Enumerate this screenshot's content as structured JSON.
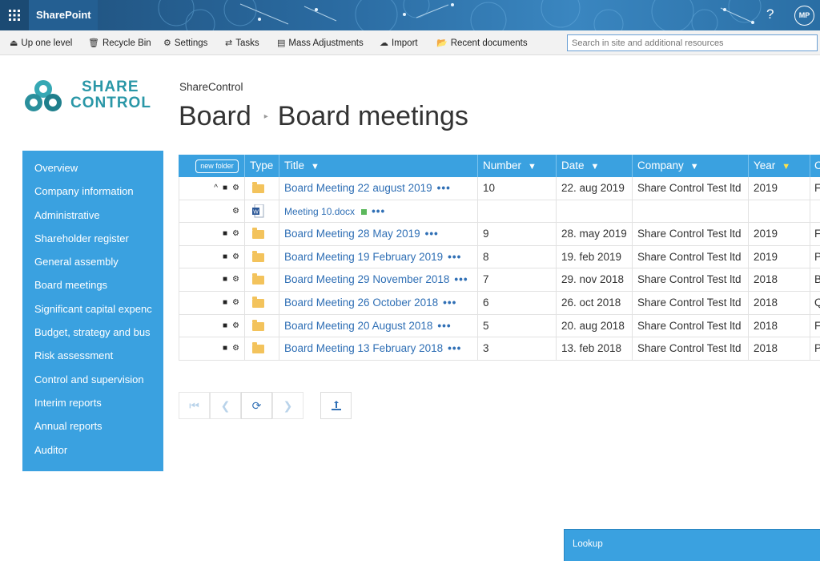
{
  "suite": {
    "brand": "SharePoint",
    "help": "?",
    "avatar": "MP"
  },
  "commands": [
    {
      "label": "Up one level",
      "icon": "eject-icon"
    },
    {
      "label": "Recycle Bin",
      "icon": "trash-icon"
    },
    {
      "label": "Settings",
      "icon": "gear-icon"
    },
    {
      "label": "Tasks",
      "icon": "arrows-icon"
    },
    {
      "label": "Mass Adjustments",
      "icon": "list-icon"
    },
    {
      "label": "Import",
      "icon": "cloud-upload-icon"
    },
    {
      "label": "Recent documents",
      "icon": "folder-open-icon"
    }
  ],
  "search": {
    "placeholder": "Search in site and additional resources"
  },
  "logo": {
    "line1": "SHARE",
    "line2": "CONTROL"
  },
  "site_name": "ShareControl",
  "breadcrumb": {
    "parent": "Board",
    "current": "Board meetings"
  },
  "sidebar": {
    "items": [
      "Overview",
      "Company information",
      "Administrative",
      "Shareholder register",
      "General assembly",
      "Board meetings",
      "Significant capital expenc",
      "Budget, strategy and bus",
      "Risk assessment",
      "Control and supervision",
      "Interim reports",
      "Annual reports",
      "Auditor"
    ]
  },
  "grid": {
    "new_folder": "new folder",
    "headers": {
      "type": "Type",
      "title": "Title",
      "number": "Number",
      "date": "Date",
      "company": "Company",
      "year": "Year",
      "more": "C"
    },
    "rows": [
      {
        "expand": "^",
        "title": "Board Meeting 22 august 2019",
        "number": "10",
        "date": "22. aug 2019",
        "company": "Share Control Test ltd",
        "year": "2019",
        "more": "F"
      },
      {
        "child": true,
        "title": "Meeting 10.docx",
        "number": "",
        "date": "",
        "company": "",
        "year": "",
        "more": ""
      },
      {
        "title": "Board Meeting 28 May 2019",
        "number": "9",
        "date": "28. may 2019",
        "company": "Share Control Test ltd",
        "year": "2019",
        "more": "F"
      },
      {
        "title": "Board Meeting 19 February 2019",
        "number": "8",
        "date": "19. feb 2019",
        "company": "Share Control Test ltd",
        "year": "2019",
        "more": "P"
      },
      {
        "title": "Board Meeting 29 November 2018",
        "number": "7",
        "date": "29. nov 2018",
        "company": "Share Control Test ltd",
        "year": "2018",
        "more": "B"
      },
      {
        "title": "Board Meeting 26 October 2018",
        "number": "6",
        "date": "26. oct 2018",
        "company": "Share Control Test ltd",
        "year": "2018",
        "more": "Q"
      },
      {
        "title": "Board Meeting 20 August 2018",
        "number": "5",
        "date": "20. aug 2018",
        "company": "Share Control Test ltd",
        "year": "2018",
        "more": "F"
      },
      {
        "title": "Board Meeting 13 February 2018",
        "number": "3",
        "date": "13. feb 2018",
        "company": "Share Control Test ltd",
        "year": "2018",
        "more": "P"
      }
    ]
  },
  "lookup": {
    "label": "Lookup"
  },
  "colors": {
    "accent": "#3aa1e0",
    "link": "#2f6fb5",
    "folder": "#f3c35c",
    "logo": "#2a97a7"
  }
}
